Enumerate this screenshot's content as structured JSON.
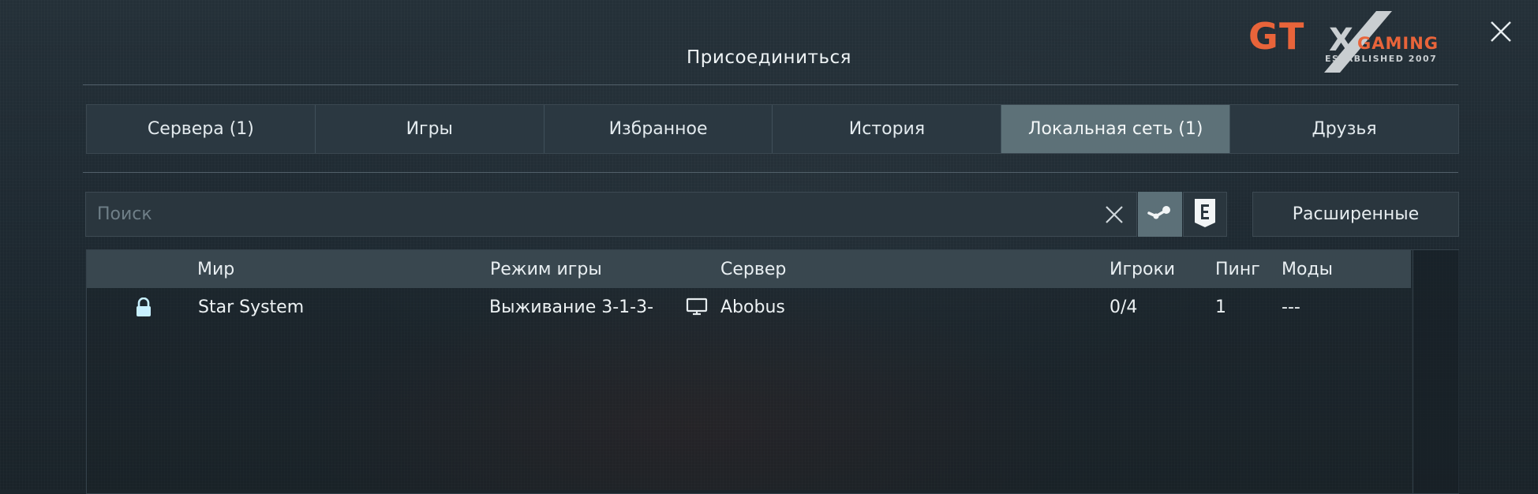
{
  "window": {
    "title": "Присоединиться"
  },
  "logo": {
    "brand": "GTX",
    "sub": "GAMING",
    "tagline": "ESTABLISHED 2007",
    "accent": "#e8643a"
  },
  "tabs": [
    {
      "label": "Сервера (1)",
      "active": false
    },
    {
      "label": "Игры",
      "active": false
    },
    {
      "label": "Избранное",
      "active": false
    },
    {
      "label": "История",
      "active": false
    },
    {
      "label": "Локальная сеть (1)",
      "active": true
    },
    {
      "label": "Друзья",
      "active": false
    }
  ],
  "search": {
    "placeholder": "Поиск",
    "value": ""
  },
  "platforms": {
    "steam_icon": "steam-icon",
    "epic_icon": "epic-games-icon",
    "steam_selected": true
  },
  "advanced_label": "Расширенные",
  "table": {
    "headers": {
      "world": "Мир",
      "mode": "Режим игры",
      "server": "Сервер",
      "players": "Игроки",
      "ping": "Пинг",
      "mods": "Моды"
    },
    "rows": [
      {
        "locked": true,
        "world": "Star System",
        "mode": "Выживание 3-1-3-",
        "server_icon": "monitor-icon",
        "server": "Abobus",
        "players": "0/4",
        "ping": "1",
        "mods": "---"
      }
    ]
  },
  "colors": {
    "active_tab": "#5d7178",
    "panel": "#2a363e",
    "background": "#1c262d"
  }
}
